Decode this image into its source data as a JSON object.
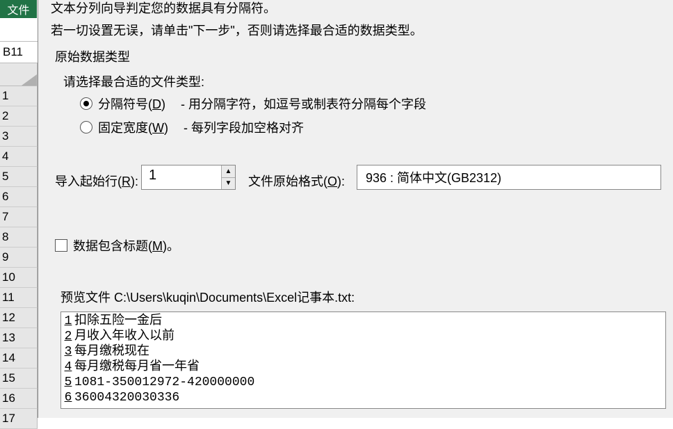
{
  "tab": {
    "file": "文件"
  },
  "name_box": "B11",
  "rows": [
    "1",
    "2",
    "3",
    "4",
    "5",
    "6",
    "7",
    "8",
    "9",
    "10",
    "11",
    "12",
    "13",
    "14",
    "15",
    "16",
    "17"
  ],
  "dialog": {
    "truncated_line": "文本分列向导判定您的数据具有分隔符。",
    "instruction": "若一切设置无误，请单击\"下一步\"，否则请选择最合适的数据类型。",
    "group_label": "原始数据类型",
    "file_type_prompt": "请选择最合适的文件类型:",
    "radio1": {
      "label_pre": "分隔符号(",
      "hotkey": "D",
      "label_post": ")",
      "desc": "- 用分隔字符，如逗号或制表符分隔每个字段"
    },
    "radio2": {
      "label_pre": "固定宽度(",
      "hotkey": "W",
      "label_post": ")",
      "desc": "- 每列字段加空格对齐"
    },
    "start_row": {
      "label_pre": "导入起始行(",
      "hotkey": "R",
      "label_post": "):",
      "value": "1"
    },
    "encoding": {
      "label_pre": "文件原始格式(",
      "hotkey": "O",
      "label_post": "):",
      "value": "936 : 简体中文(GB2312)"
    },
    "headers_chk": {
      "label_pre": "数据包含标题(",
      "hotkey": "M",
      "label_post": ")。"
    },
    "preview_label_pre": "预览文件 ",
    "preview_path": "C:\\Users\\kuqin\\Documents\\Excel记事本.txt:",
    "preview_rows": [
      {
        "n": "1",
        "t": "扣除五险一金后"
      },
      {
        "n": "2",
        "t": "月收入年收入以前"
      },
      {
        "n": "3",
        "t": "每月缴税现在"
      },
      {
        "n": "4",
        "t": "每月缴税每月省一年省"
      },
      {
        "n": "5",
        "t": "1081-350012972-420000000"
      },
      {
        "n": "6",
        "t": "36004320030336"
      }
    ]
  }
}
